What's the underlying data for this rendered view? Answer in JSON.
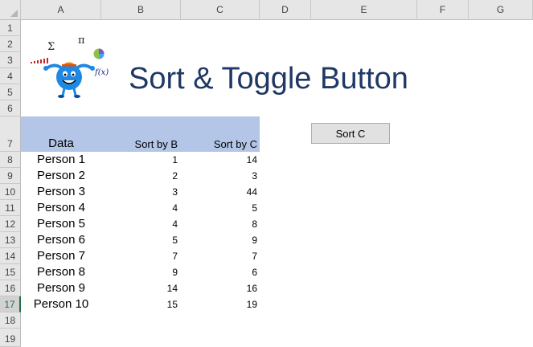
{
  "columns": [
    "A",
    "B",
    "C",
    "D",
    "E",
    "F",
    "G"
  ],
  "rows": [
    "1",
    "2",
    "3",
    "4",
    "5",
    "6",
    "7",
    "8",
    "9",
    "10",
    "11",
    "12",
    "13",
    "14",
    "15",
    "16",
    "17",
    "18",
    "19"
  ],
  "active_row": "17",
  "title": "Sort & Toggle Button",
  "button_label": "Sort C",
  "table": {
    "headers": [
      "Data",
      "Sort by B",
      "Sort by C"
    ],
    "rows": [
      [
        "Person 1",
        "1",
        "14"
      ],
      [
        "Person 2",
        "2",
        "3"
      ],
      [
        "Person 3",
        "3",
        "44"
      ],
      [
        "Person 4",
        "4",
        "5"
      ],
      [
        "Person 5",
        "4",
        "8"
      ],
      [
        "Person 6",
        "5",
        "9"
      ],
      [
        "Person 7",
        "7",
        "7"
      ],
      [
        "Person 8",
        "9",
        "6"
      ],
      [
        "Person 9",
        "14",
        "16"
      ],
      [
        "Person 10",
        "15",
        "19"
      ]
    ]
  },
  "clipart": {
    "symbols": [
      "Σ",
      "π",
      "f(x)"
    ],
    "icon_names": [
      "sigma-icon",
      "pi-icon",
      "bar-chart-icon",
      "pie-chart-icon",
      "function-icon",
      "mascot-icon"
    ],
    "colors": {
      "title": "#1f3864",
      "header_band": "#b4c6e7",
      "mascot": "#1e88e5",
      "hat": "#f57c00"
    }
  }
}
